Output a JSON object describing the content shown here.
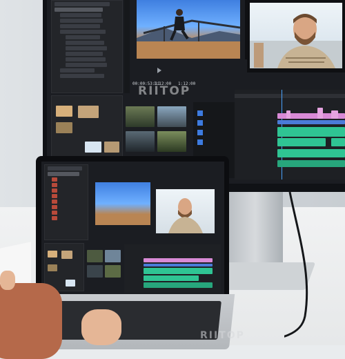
{
  "watermarks": {
    "monitor": "RIITOP",
    "laptop": "RIITOP"
  },
  "program": {
    "timecode_left": "00:00:53:11",
    "timecode_mid": "1:12:00",
    "timecode_right": "1:12:00"
  },
  "colors": {
    "ui_dark": "#1b1d22",
    "timeline_green": "#2fc493",
    "timeline_pink": "#d98ad6",
    "timeline_blue": "#4a7bd8",
    "sleeve": "#b5694a"
  },
  "icons": [
    "folder-icon",
    "play-icon",
    "usb-c-cable-icon"
  ]
}
